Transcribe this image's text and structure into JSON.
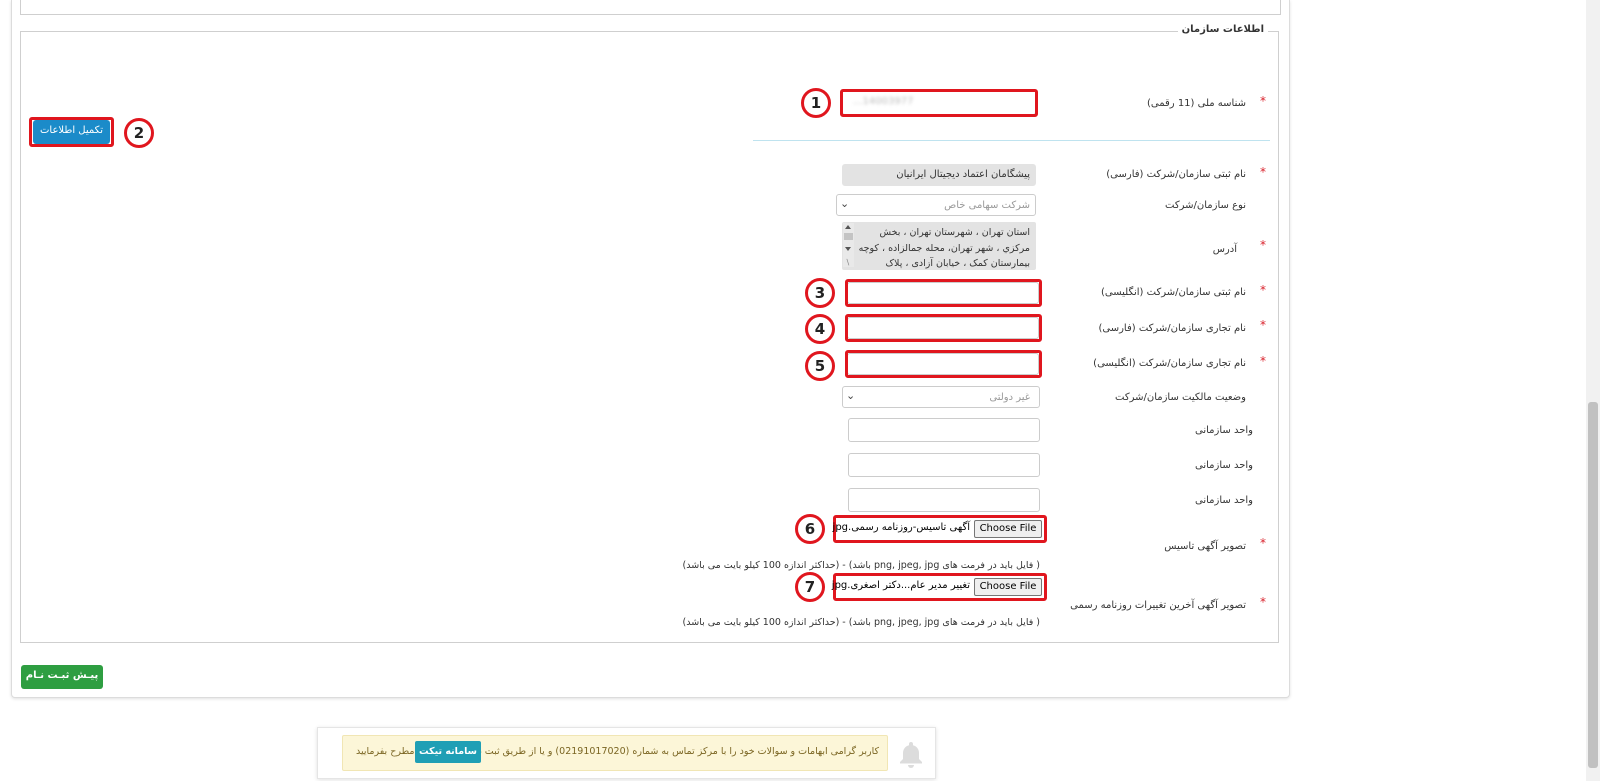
{
  "section_title": "اطلاعات سازمان",
  "fields": {
    "national_id": {
      "label": "شناسه ملی (11 رقمی)",
      "value": "14003977..."
    },
    "reg_name_fa": {
      "label": "نام ثبتی سازمان/شرکت (فارسی)",
      "value": "پیشگامان اعتماد دیجیتال ایرانیان"
    },
    "org_type": {
      "label": "نوع سازمان/شرکت",
      "value": "شرکت سهامی خاص"
    },
    "address": {
      "label": "آدرس",
      "lines": [
        "استان تهران ، شهرستان تهران ، بخش",
        "مرکزي ، شهر تهران، محله جمالزاده ، کوچه",
        "بیمارستان کمک ، خیابان آزادی ، پلاک"
      ]
    },
    "reg_name_en": {
      "label": "نام ثبتی سازمان/شرکت (انگلیسی)",
      "value": ""
    },
    "trade_name_fa": {
      "label": "نام تجاری سازمان/شرکت (فارسی)",
      "value": ""
    },
    "trade_name_en": {
      "label": "نام تجاری سازمان/شرکت (انگلیسی)",
      "value": ""
    },
    "ownership": {
      "label": "وضعیت مالکیت سازمان/شرکت",
      "value": "غیر دولتی"
    },
    "unit1": {
      "label": "واحد سازمانی",
      "value": ""
    },
    "unit2": {
      "label": "واحد سازمانی",
      "value": ""
    },
    "unit3": {
      "label": "واحد سازمانی",
      "value": ""
    },
    "founding_ad": {
      "label": "تصویر آگهی تاسیس",
      "button": "Choose File",
      "file": "آگهی تاسیس-روزنامه رسمی.jpg",
      "note": "( فایل باید در فرمت های png, jpeg, jpg باشد) - (حداکثر اندازه 100 کیلو بایت می باشد)"
    },
    "last_changes_ad": {
      "label": "تصویر آگهی آخرین تغییرات روزنامه رسمی",
      "button": "Choose File",
      "file": "تغییر مدیر عام...دکتر اصغری.jpg",
      "note": "( فایل باید در فرمت های png, jpeg, jpg باشد) - (حداکثر اندازه 100 کیلو بایت می باشد)"
    }
  },
  "complete_button": "تکمیل اطلاعات",
  "preregister_button": "پیـش ثبـت نـام",
  "markers": [
    "1",
    "2",
    "3",
    "4",
    "5",
    "6",
    "7"
  ],
  "required_mark": "*",
  "notification": {
    "text_before": "کاربر گرامی ابهامات و سوالات خود را با مرکز تماس به شماره (02191017020) و یا از طریق ثبت در",
    "ticket_button": "سامانه تیکت",
    "text_after": "مطرح بفرمایید"
  },
  "colors": {
    "accent_blue": "#1b8bc9",
    "accent_green": "#2e9e41",
    "highlight_red": "#e0161e",
    "required_red": "#d9232d"
  }
}
